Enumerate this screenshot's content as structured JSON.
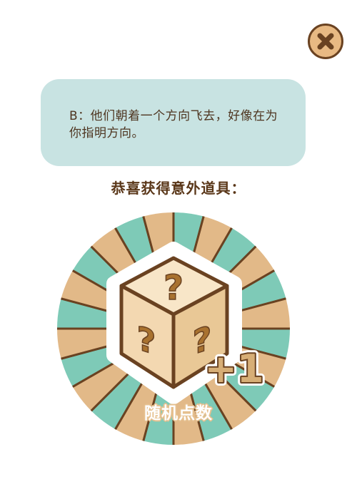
{
  "close_button": {
    "icon": "close-x-icon"
  },
  "dialog": {
    "text": "B：他们朝着一个方向飞去，好像在为你指明方向。"
  },
  "reward": {
    "headline": "恭喜获得意外道具：",
    "item_name": "随机点数",
    "bonus_label": "+1",
    "icon": "mystery-dice-icon",
    "dice_marks": [
      "?",
      "?",
      "?"
    ]
  },
  "colors": {
    "dialog_bg": "#c8e3e2",
    "ray_teal": "#7ecab7",
    "ray_tan": "#e2b988",
    "outline_brown": "#6a4221",
    "cube_face": "#f4dcb8"
  }
}
